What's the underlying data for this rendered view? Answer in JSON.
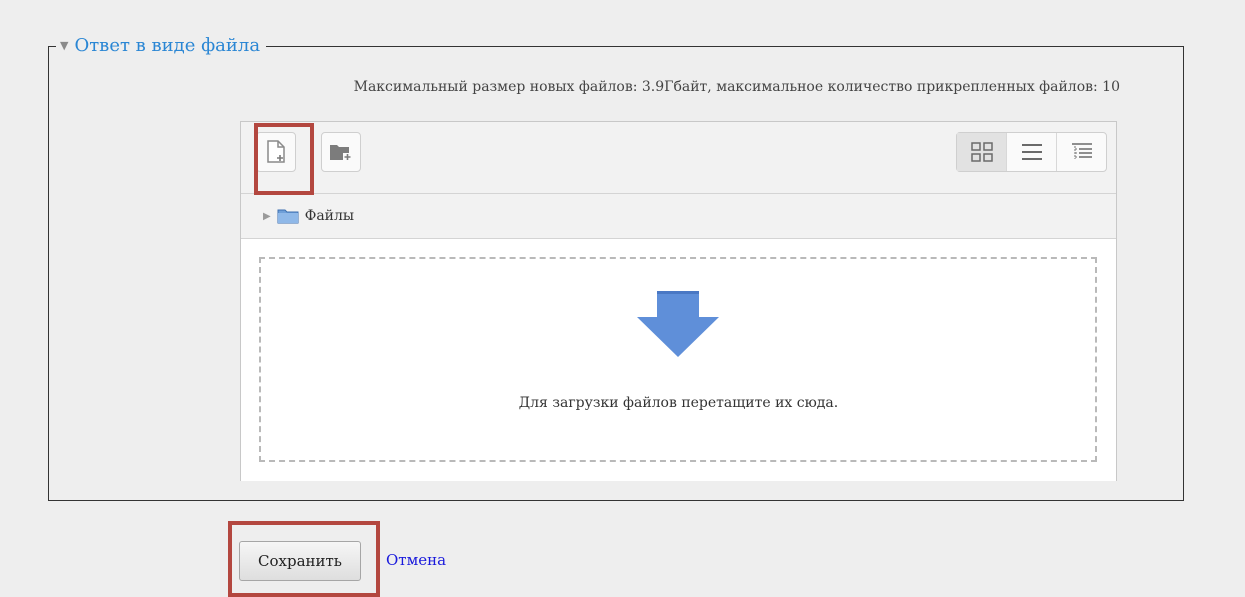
{
  "section": {
    "title": "Ответ в виде файла",
    "collapse_icon": "triangle-down-icon"
  },
  "limits_text": "Максимальный размер новых файлов: 3.9Гбайт, максимальное количество прикрепленных файлов: 10",
  "file_manager": {
    "toolbar": {
      "add_file_icon": "add-file-icon",
      "add_folder_icon": "add-folder-icon",
      "views": [
        "icons-view-icon",
        "list-view-icon",
        "tree-view-icon"
      ]
    },
    "path": {
      "label": "Файлы",
      "icon": "folder-icon"
    },
    "drop_zone": {
      "hint": "Для загрузки файлов перетащите их сюда.",
      "icon": "down-arrow-icon"
    }
  },
  "actions": {
    "save_label": "Сохранить",
    "cancel_label": "Отмена"
  },
  "colors": {
    "title": "#2a86d4",
    "highlight": "#b3473f",
    "link": "#1a1adc",
    "arrow": "#5b8ad6"
  }
}
